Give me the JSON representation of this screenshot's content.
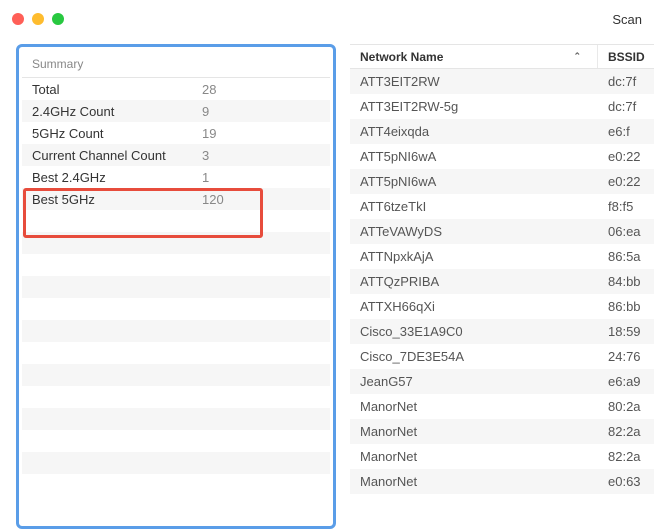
{
  "toolbar": {
    "scan_label": "Scan"
  },
  "summary": {
    "header": "Summary",
    "rows": [
      {
        "label": "Total",
        "value": "28"
      },
      {
        "label": "2.4GHz Count",
        "value": "9"
      },
      {
        "label": "5GHz Count",
        "value": "19"
      },
      {
        "label": "Current Channel Count",
        "value": "3"
      },
      {
        "label": "Best 2.4GHz",
        "value": "1"
      },
      {
        "label": "Best 5GHz",
        "value": "120"
      }
    ]
  },
  "networks": {
    "header_name": "Network Name",
    "header_bssid": "BSSID",
    "rows": [
      {
        "name": "ATT3EIT2RW",
        "bssid": "dc:7f"
      },
      {
        "name": "ATT3EIT2RW-5g",
        "bssid": "dc:7f"
      },
      {
        "name": "ATT4eixqda",
        "bssid": "e6:f"
      },
      {
        "name": "ATT5pNI6wA",
        "bssid": "e0:22"
      },
      {
        "name": "ATT5pNI6wA",
        "bssid": "e0:22"
      },
      {
        "name": "ATT6tzeTkI",
        "bssid": "f8:f5"
      },
      {
        "name": "ATTeVAWyDS",
        "bssid": "06:ea"
      },
      {
        "name": "ATTNpxkAjA",
        "bssid": "86:5a"
      },
      {
        "name": "ATTQzPRIBA",
        "bssid": "84:bb"
      },
      {
        "name": "ATTXH66qXi",
        "bssid": "86:bb"
      },
      {
        "name": "Cisco_33E1A9C0",
        "bssid": "18:59"
      },
      {
        "name": "Cisco_7DE3E54A",
        "bssid": "24:76"
      },
      {
        "name": "JeanG57",
        "bssid": "e6:a9"
      },
      {
        "name": "ManorNet",
        "bssid": "80:2a"
      },
      {
        "name": "ManorNet",
        "bssid": "82:2a"
      },
      {
        "name": "ManorNet",
        "bssid": "82:2a"
      },
      {
        "name": "ManorNet",
        "bssid": "e0:63"
      }
    ]
  }
}
